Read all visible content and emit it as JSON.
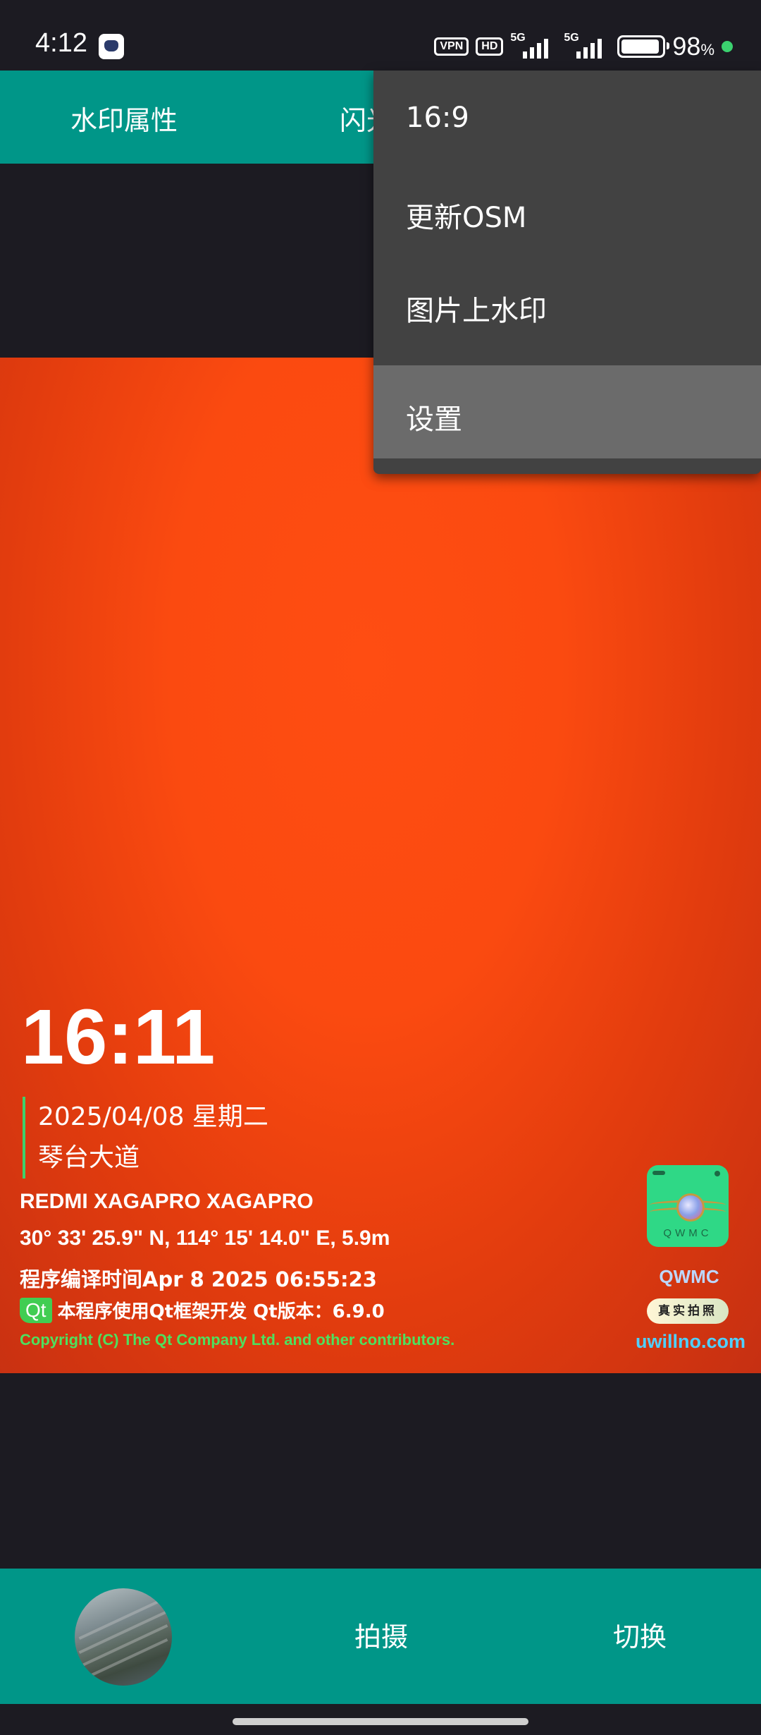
{
  "status_bar": {
    "time": "4:12",
    "vpn": "VPN",
    "hd": "HD",
    "net1": "5G",
    "net2": "5G",
    "battery_value": "98",
    "battery_unit": "%"
  },
  "tabs": [
    {
      "label": "水印属性"
    },
    {
      "label": "闪光"
    }
  ],
  "menu": {
    "items": [
      {
        "label": "16:9",
        "selected": false
      },
      {
        "label": "更新OSM",
        "selected": false
      },
      {
        "label": "图片上水印",
        "selected": false
      },
      {
        "label": "设置",
        "selected": true
      }
    ]
  },
  "watermark": {
    "time": "16:11",
    "date": "2025/04/08 星期二",
    "location": "琴台大道",
    "device": "REDMI XAGAPRO XAGAPRO",
    "coords": "30° 33' 25.9\" N, 114° 15' 14.0\" E, 5.9m",
    "build": "程序编译时间Apr  8 2025 06:55:23",
    "qt_logo": "Qt",
    "qt_note": "本程序使用Qt框架开发 Qt版本：6.9.0",
    "copyright": "Copyright (C) The Qt Company Ltd. and other contributors.",
    "logo_text": "QWMC",
    "brand": "QWMC",
    "badge": "真实拍照",
    "site": "uwillno.com"
  },
  "bottom_bar": {
    "shoot_label": "拍摄",
    "switch_label": "切换"
  },
  "colors": {
    "accent": "#009688",
    "menu_bg": "#424242",
    "menu_selected": "#6b6b6b",
    "preview": "#ff4d12"
  }
}
